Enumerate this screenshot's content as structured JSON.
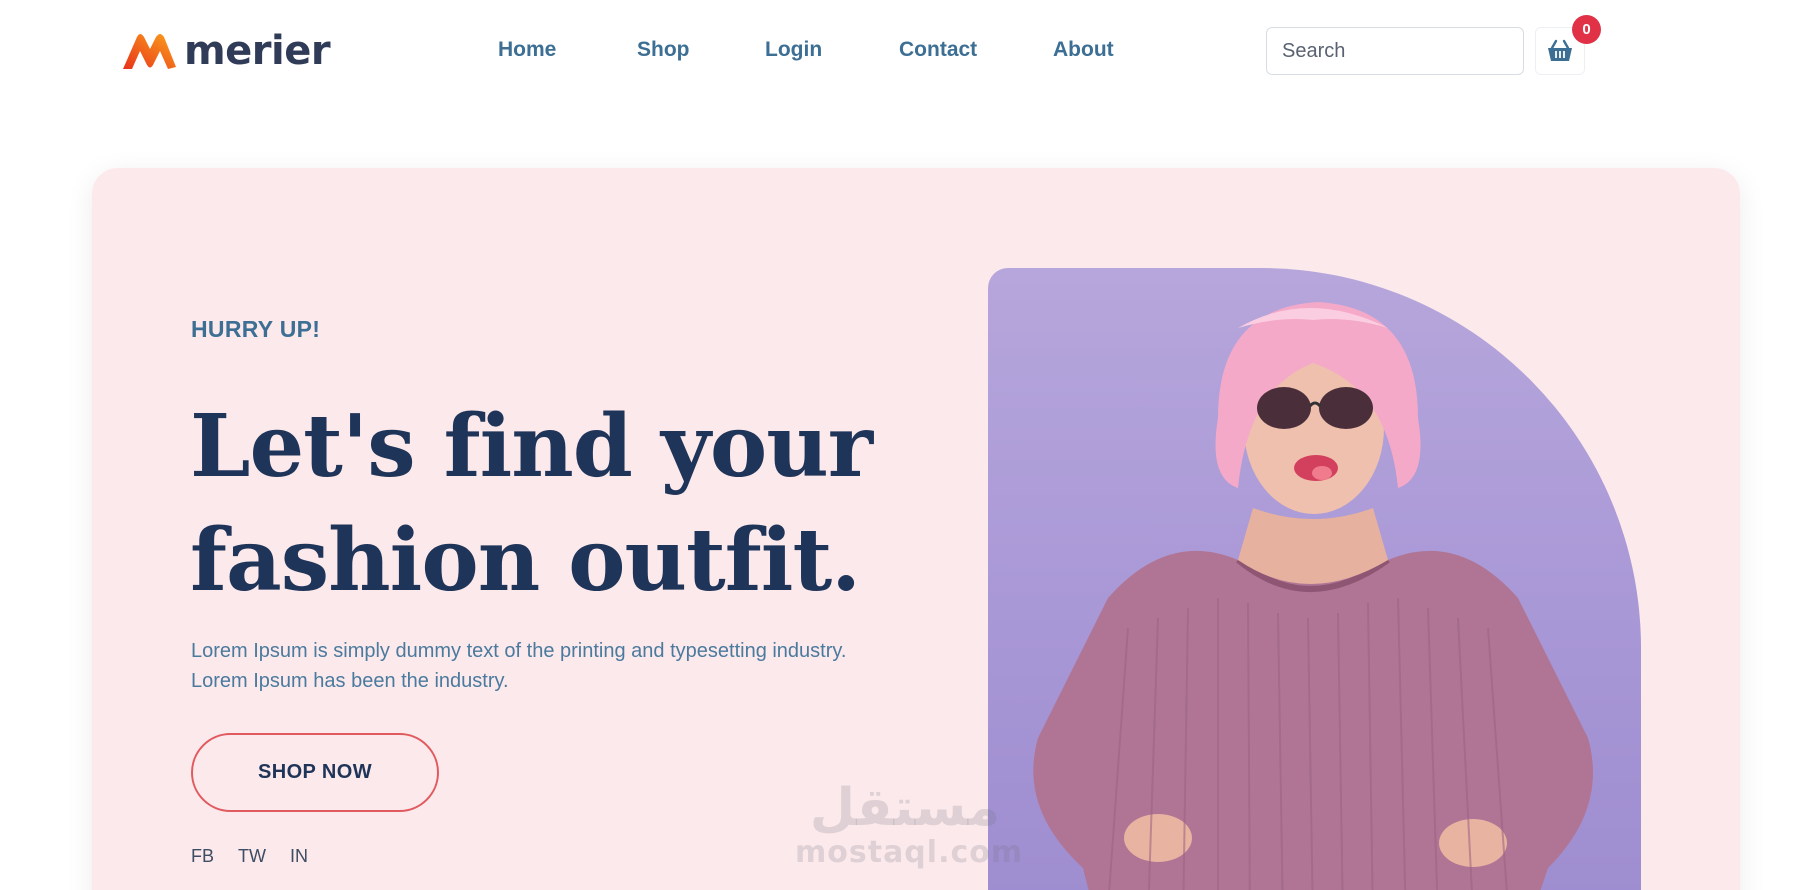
{
  "brand": {
    "name": "merier"
  },
  "nav": [
    {
      "label": "Home"
    },
    {
      "label": "Shop"
    },
    {
      "label": "Login"
    },
    {
      "label": "Contact"
    },
    {
      "label": "About"
    }
  ],
  "search": {
    "placeholder": "Search",
    "value": ""
  },
  "cart": {
    "count": "0",
    "icon": "basket-icon"
  },
  "hero": {
    "kicker": "HURRY UP!",
    "headline_line1": "Let's find your",
    "headline_line2": "fashion outfit.",
    "desc_line1": "Lorem Ipsum is simply dummy text of the printing and typesetting industry.",
    "desc_line2": "Lorem Ipsum has been the industry.",
    "cta": "SHOP NOW",
    "socials": [
      "FB",
      "TW",
      "IN"
    ]
  },
  "watermark": {
    "arabic": "مستقل",
    "latin": "mostaql.com"
  },
  "colors": {
    "accent": "#3c6f93",
    "heading": "#1f3459",
    "hero_bg": "#fce9eb",
    "button_border": "#e05a5f",
    "badge": "#e03147",
    "photo_bg": "#b6a6db"
  }
}
